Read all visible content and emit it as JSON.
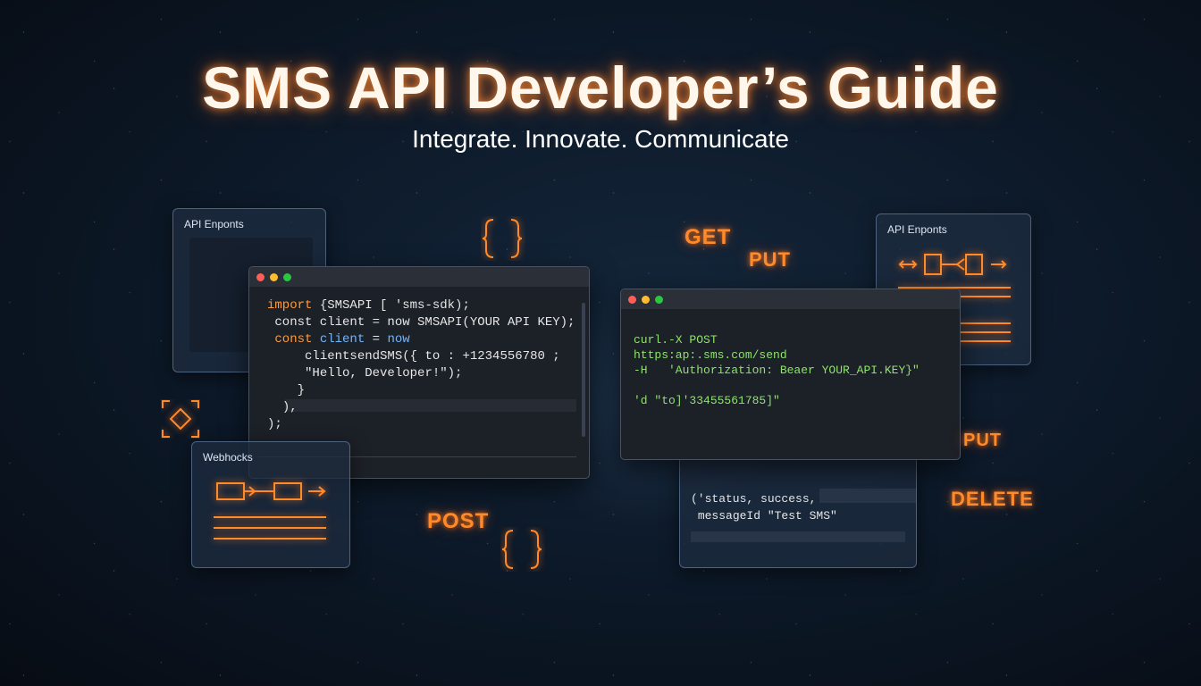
{
  "header": {
    "title": "SMS API Developer’s Guide",
    "subtitle": "Integrate. Innovate. Communicate"
  },
  "panels": {
    "left_top_title": "API Enponts",
    "right_top_title": "API Enponts",
    "webhooks_title": "Webhocks"
  },
  "left_editor": {
    "line1_kw": "import",
    "line1_rest": " {SMSAPI [ 'sms-sdk);",
    "line2": " const client = now SMSAPI(YOUR API KEY);",
    "line3_kw": "const ",
    "line3_var": "client",
    "line3_eq": " = ",
    "line3_now": "now",
    "line4": "  clientsendSMS({ to : +1234556780 ;",
    "line5": "  \"Hello, Developer!\");",
    "line6": " }",
    "line7": "),",
    "line8": ");"
  },
  "right_editor": {
    "line1": "curl.-X POST",
    "line2": "https:ap:.sms.com/send",
    "line3": "-H   'Authorization: Beaer YOUR_API.KEY}\"",
    "line4": "'d \"to]'33455561785]\""
  },
  "response_panel": {
    "line1": "('status, success,",
    "line2": "messageId \"Test SMS\""
  },
  "methods": {
    "get": "GET",
    "put_top": "PUT",
    "put_right": "PUT",
    "delete": "DELETE",
    "post": "POST"
  },
  "colors": {
    "neon_orange": "#ff8a2a",
    "code_green": "#8fe36d",
    "keyword_orange": "#ff9a3c",
    "variable_blue": "#6fb6ff"
  }
}
